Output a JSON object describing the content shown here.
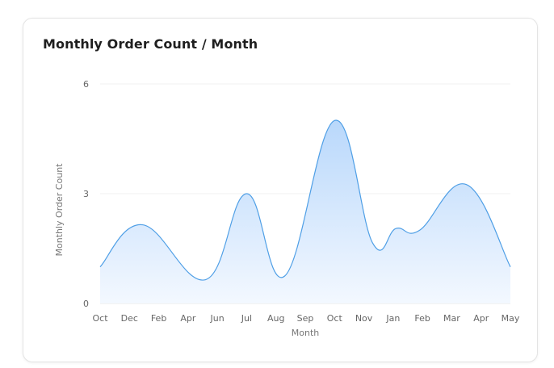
{
  "card": {
    "title": "Monthly Order Count / Month"
  },
  "chart_data": {
    "type": "area",
    "title": "Monthly Order Count / Month",
    "xlabel": "Month",
    "ylabel": "Monthly Order Count",
    "categories": [
      "Oct",
      "Dec",
      "Feb",
      "Apr",
      "Jun",
      "Jul",
      "Aug",
      "Sep",
      "Oct",
      "Nov",
      "Jan",
      "Feb",
      "Mar",
      "Apr",
      "May"
    ],
    "points": [
      {
        "x": 0.0,
        "y": 1.0
      },
      {
        "x": 1.45,
        "y": 2.15
      },
      {
        "x": 3.6,
        "y": 0.65
      },
      {
        "x": 5.0,
        "y": 3.0
      },
      {
        "x": 6.3,
        "y": 0.75
      },
      {
        "x": 8.0,
        "y": 5.0
      },
      {
        "x": 9.3,
        "y": 1.65
      },
      {
        "x": 10.1,
        "y": 2.05
      },
      {
        "x": 10.9,
        "y": 2.0
      },
      {
        "x": 12.5,
        "y": 3.25
      },
      {
        "x": 14.0,
        "y": 1.0
      }
    ],
    "ylim": [
      0,
      6
    ],
    "yticks": [
      0,
      3,
      6
    ],
    "grid": true,
    "legend": "none",
    "colors": {
      "line": "#4f9fe6",
      "fill_top": "#b9d8fb",
      "fill_bottom": "#f3f8ff",
      "grid": "#f0f0f0",
      "axis": "#e6e6e6"
    }
  }
}
